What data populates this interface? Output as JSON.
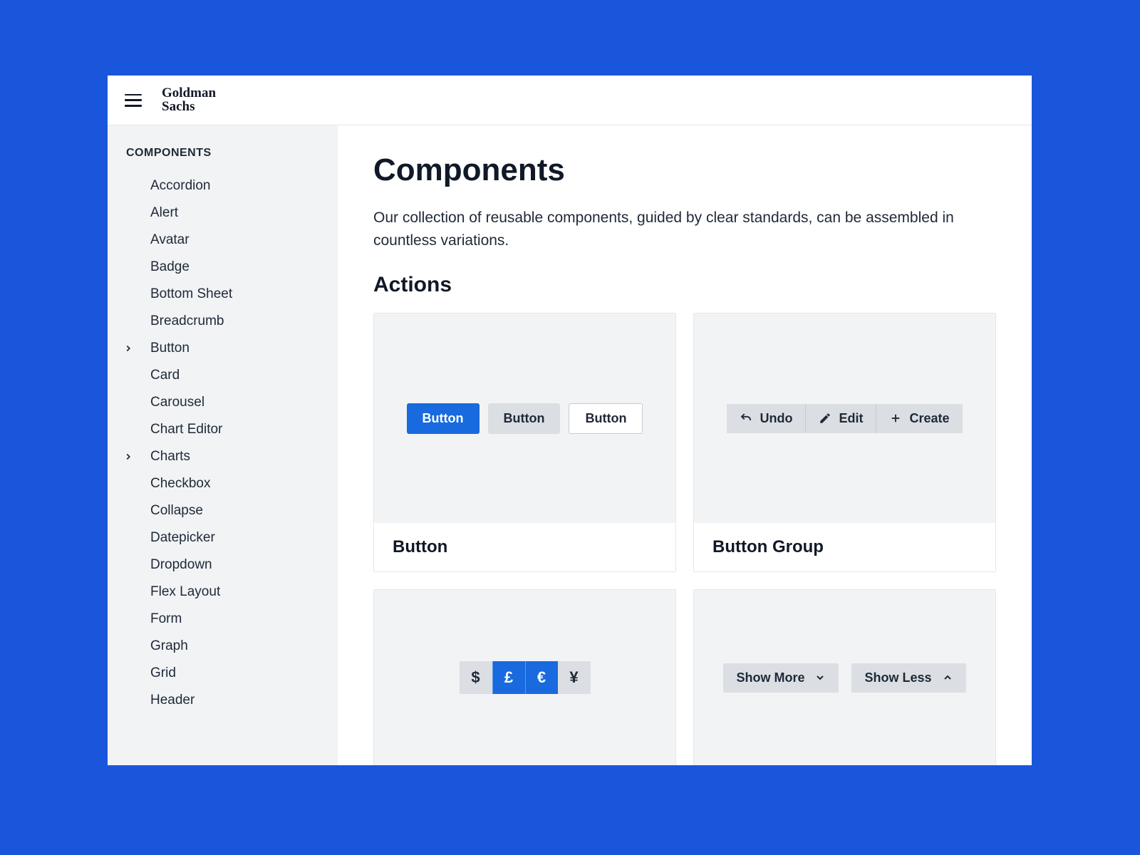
{
  "logo": {
    "line1": "Goldman",
    "line2": "Sachs"
  },
  "sidebar": {
    "title": "COMPONENTS",
    "items": [
      {
        "label": "Accordion",
        "expandable": false
      },
      {
        "label": "Alert",
        "expandable": false
      },
      {
        "label": "Avatar",
        "expandable": false
      },
      {
        "label": "Badge",
        "expandable": false
      },
      {
        "label": "Bottom Sheet",
        "expandable": false
      },
      {
        "label": "Breadcrumb",
        "expandable": false
      },
      {
        "label": "Button",
        "expandable": true
      },
      {
        "label": "Card",
        "expandable": false
      },
      {
        "label": "Carousel",
        "expandable": false
      },
      {
        "label": "Chart Editor",
        "expandable": false
      },
      {
        "label": "Charts",
        "expandable": true
      },
      {
        "label": "Checkbox",
        "expandable": false
      },
      {
        "label": "Collapse",
        "expandable": false
      },
      {
        "label": "Datepicker",
        "expandable": false
      },
      {
        "label": "Dropdown",
        "expandable": false
      },
      {
        "label": "Flex Layout",
        "expandable": false
      },
      {
        "label": "Form",
        "expandable": false
      },
      {
        "label": "Graph",
        "expandable": false
      },
      {
        "label": "Grid",
        "expandable": false
      },
      {
        "label": "Header",
        "expandable": false
      }
    ]
  },
  "main": {
    "title": "Components",
    "description": "Our collection of reusable components, guided by clear standards, can be assembled in countless variations.",
    "section_title": "Actions",
    "cards": {
      "button": {
        "title": "Button",
        "examples": {
          "primary": "Button",
          "secondary": "Button",
          "outline": "Button"
        }
      },
      "button_group": {
        "title": "Button Group",
        "items": [
          {
            "icon": "undo",
            "label": "Undo"
          },
          {
            "icon": "edit",
            "label": "Edit"
          },
          {
            "icon": "plus",
            "label": "Create"
          }
        ]
      },
      "segmented": {
        "items": [
          {
            "symbol": "$",
            "selected": false
          },
          {
            "symbol": "£",
            "selected": true
          },
          {
            "symbol": "€",
            "selected": true
          },
          {
            "symbol": "¥",
            "selected": false
          }
        ]
      },
      "toggle": {
        "show_more": "Show More",
        "show_less": "Show Less"
      }
    }
  }
}
